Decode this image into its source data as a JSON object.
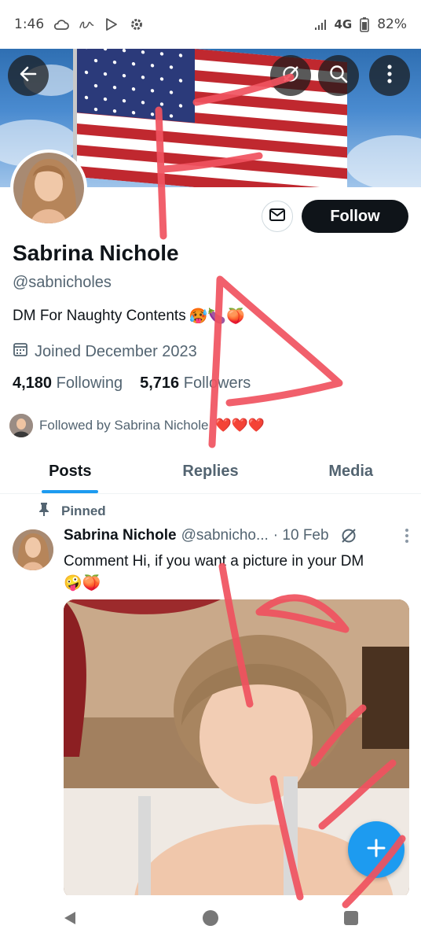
{
  "status_bar": {
    "time": "1:46",
    "signal_label": "4G",
    "battery": "82%",
    "icons": [
      "cloud-icon",
      "signature-icon",
      "play-store-icon",
      "gear-icon",
      "signal-icon",
      "battery-icon"
    ]
  },
  "header": {
    "back_icon": "arrow-left-icon",
    "grok_icon": "grok-icon",
    "search_icon": "search-icon",
    "more_icon": "more-vertical-icon"
  },
  "profile": {
    "name": "Sabrina Nichole",
    "handle": "@sabnicholes",
    "bio": "DM For Naughty Contents",
    "bio_emojis": "🥵🍆🍑",
    "joined": "Joined December 2023",
    "following_count": "4,180",
    "following_label": "Following",
    "followers_count": "5,716",
    "followers_label": "Followers",
    "followed_by": "Followed by Sabrina Nichole",
    "followed_by_hearts": "❤️❤️❤️",
    "follow_button": "Follow",
    "message_icon": "mail-icon"
  },
  "tabs": [
    {
      "label": "Posts",
      "active": true
    },
    {
      "label": "Replies",
      "active": false
    },
    {
      "label": "Media",
      "active": false
    }
  ],
  "post": {
    "pinned_label": "Pinned",
    "author_name": "Sabrina Nichole",
    "author_handle": "@sabnicho...",
    "date": "· 10 Feb",
    "text_line1": "Comment Hi, if you want a picture in your DM",
    "text_line2": "🤪🍑"
  },
  "fab": {
    "icon": "plus-icon"
  },
  "nav": {
    "icons": [
      "back-triangle-icon",
      "home-circle-icon",
      "recents-square-icon"
    ]
  },
  "colors": {
    "accent": "#1d9bf0",
    "text_primary": "#0f1419",
    "text_secondary": "#536471",
    "follow_bg": "#0f1419",
    "annotation": "#f0525f"
  }
}
